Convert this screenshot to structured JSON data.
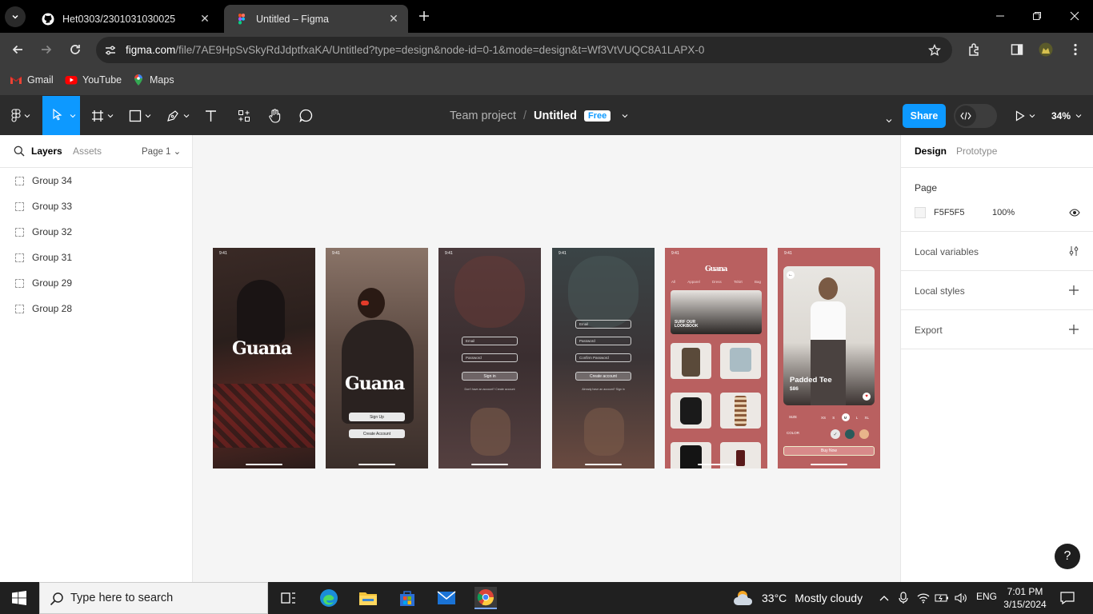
{
  "browser": {
    "tabs": [
      {
        "title": "Het0303/2301031030025"
      },
      {
        "title": "Untitled – Figma"
      }
    ],
    "url_host": "figma.com",
    "url_path": "/file/7AE9HpSvSkyRdJdptfxaKA/Untitled?type=design&node-id=0-1&mode=design&t=Wf3VtVUQC8A1LAPX-0",
    "bookmarks": [
      {
        "label": "Gmail",
        "icon": "gmail-icon"
      },
      {
        "label": "YouTube",
        "icon": "youtube-icon"
      },
      {
        "label": "Maps",
        "icon": "maps-icon"
      }
    ]
  },
  "figma": {
    "breadcrumb": {
      "team": "Team project",
      "separator": "/",
      "file": "Untitled",
      "badge": "Free"
    },
    "share_label": "Share",
    "zoom": "34%",
    "left_panel": {
      "tab_layers": "Layers",
      "tab_assets": "Assets",
      "page_label": "Page 1",
      "layers": [
        "Group 34",
        "Group 33",
        "Group 32",
        "Group 31",
        "Group 29",
        "Group 28"
      ]
    },
    "right_panel": {
      "tab_design": "Design",
      "tab_prototype": "Prototype",
      "page_title": "Page",
      "page_color": "F5F5F5",
      "page_opacity": "100%",
      "local_variables": "Local variables",
      "local_styles": "Local styles",
      "export": "Export"
    },
    "help": "?"
  },
  "frames": {
    "time": "9:41",
    "logo": "Guana",
    "sign_up": "Sign Up",
    "create_account": "Create Account",
    "email": "Email",
    "password": "Password",
    "confirm_password": "Confirm Password",
    "sign_in": "Sign in",
    "create_account_lower": "Create account",
    "no_account": "Don't have an account? Create account",
    "have_account": "Already have an account? Sign in",
    "shop": {
      "tabs": [
        "All",
        "Apparel",
        "Dress",
        "Tshirt",
        "Bag"
      ],
      "banner_line1": "SURF OUR",
      "banner_line2": "LOOKBOOK",
      "product_title": "Padded Tee",
      "product_price": "$86",
      "size_label": "SIZE",
      "sizes": [
        "XS",
        "S",
        "M",
        "L",
        "XL"
      ],
      "color_label": "COLOR",
      "buy_now": "Buy Now"
    }
  },
  "taskbar": {
    "search_placeholder": "Type here to search",
    "weather_temp": "33°C",
    "weather_text": "Mostly cloudy",
    "lang": "ENG",
    "time": "7:01 PM",
    "date": "3/15/2024"
  }
}
